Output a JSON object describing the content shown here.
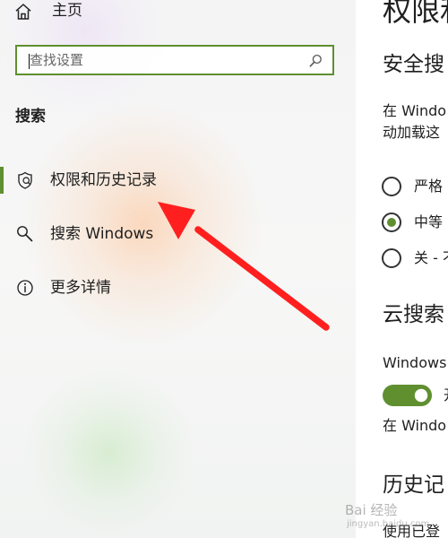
{
  "sidebar": {
    "home_label": "主页",
    "search_placeholder": "查找设置",
    "section_title": "搜索",
    "items": [
      {
        "label": "权限和历史记录",
        "icon": "shield-icon",
        "selected": true
      },
      {
        "label": "搜索 Windows",
        "icon": "search-icon",
        "selected": false
      },
      {
        "label": "更多详情",
        "icon": "info-icon",
        "selected": false
      }
    ]
  },
  "main": {
    "title": "权限和",
    "safe_search_heading": "安全搜",
    "safe_search_text_1": "在 Windo",
    "safe_search_text_2": "动加载这",
    "radios": [
      {
        "label": "严格",
        "selected": false
      },
      {
        "label": "中等",
        "selected": true
      },
      {
        "label": "关 - 不",
        "selected": false
      }
    ],
    "cloud_heading": "云搜索",
    "cloud_text": "Windows",
    "toggle_label": "开",
    "cloud_text_2": "在 Windo",
    "history_heading": "历史记",
    "history_text": "使用已登"
  },
  "watermark": {
    "logo": "Bai 经验",
    "url": "jingyan.baidu.com"
  },
  "colors": {
    "accent": "#5f8f2f",
    "arrow": "#ff1f1f"
  }
}
